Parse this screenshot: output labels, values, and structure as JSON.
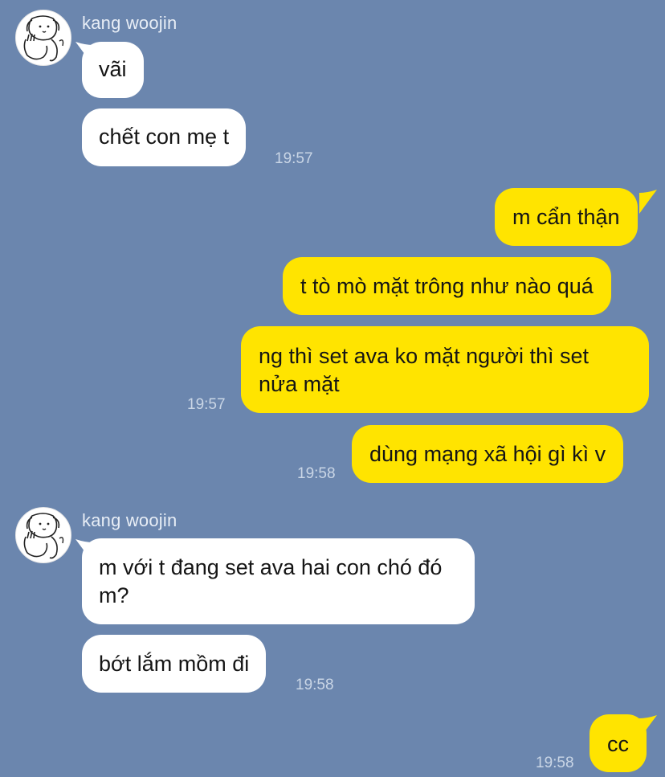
{
  "contact": {
    "name": "kang woojin",
    "avatar_icon": "dog-avatar-icon"
  },
  "colors": {
    "background": "#6b86ae",
    "incoming": "#ffffff",
    "outgoing": "#ffe400"
  },
  "messages": {
    "m1": "vãi",
    "m2": "chết con mẹ t",
    "t1": "19:57",
    "m3": "m cẩn thận",
    "m4": "t tò mò mặt trông như nào quá",
    "m5": "ng thì set ava ko mặt người thì set nửa mặt",
    "t2": "19:57",
    "m6": "dùng mạng xã hội gì kì v",
    "t3": "19:58",
    "m7": "m với t đang set ava hai con chó đó m?",
    "m8": "bớt lắm mồm đi",
    "t4": "19:58",
    "m9": "cc",
    "t5": "19:58"
  }
}
